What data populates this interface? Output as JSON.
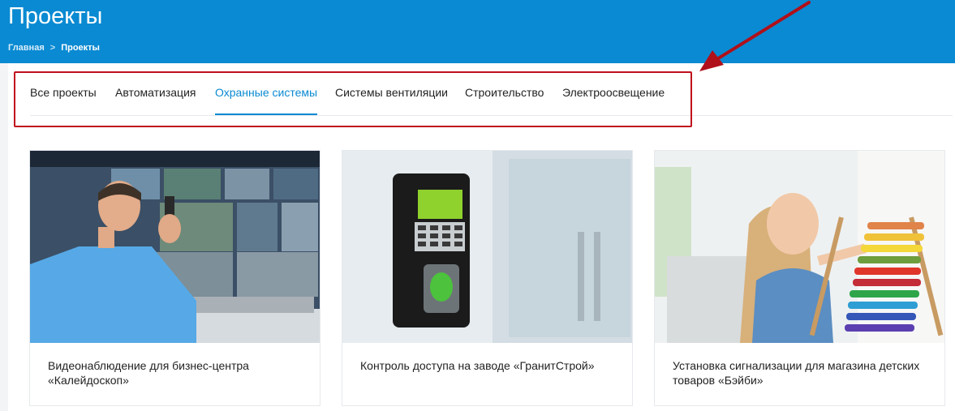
{
  "header": {
    "title": "Проекты",
    "breadcrumb": {
      "home": "Главная",
      "separator": ">",
      "current": "Проекты"
    }
  },
  "tabs": [
    {
      "label": "Все проекты",
      "active": false
    },
    {
      "label": "Автоматизация",
      "active": false
    },
    {
      "label": "Охранные системы",
      "active": true
    },
    {
      "label": "Системы вентиляции",
      "active": false
    },
    {
      "label": "Строительство",
      "active": false
    },
    {
      "label": "Электроосвещение",
      "active": false
    }
  ],
  "projects": [
    {
      "title": "Видеонаблюдение для бизнес-центра «Калейдоскоп»",
      "image": "security-guard-monitoring-photo"
    },
    {
      "title": "Контроль доступа на заводе «ГранитСтрой»",
      "image": "fingerprint-access-terminal-photo"
    },
    {
      "title": "Установка сигнализации для магазина детских товаров «Бэйби»",
      "image": "child-with-abacus-photo"
    }
  ],
  "colors": {
    "header": "#0a8ad2",
    "active_tab": "#0a8ad2",
    "annotation": "#c0101c"
  }
}
